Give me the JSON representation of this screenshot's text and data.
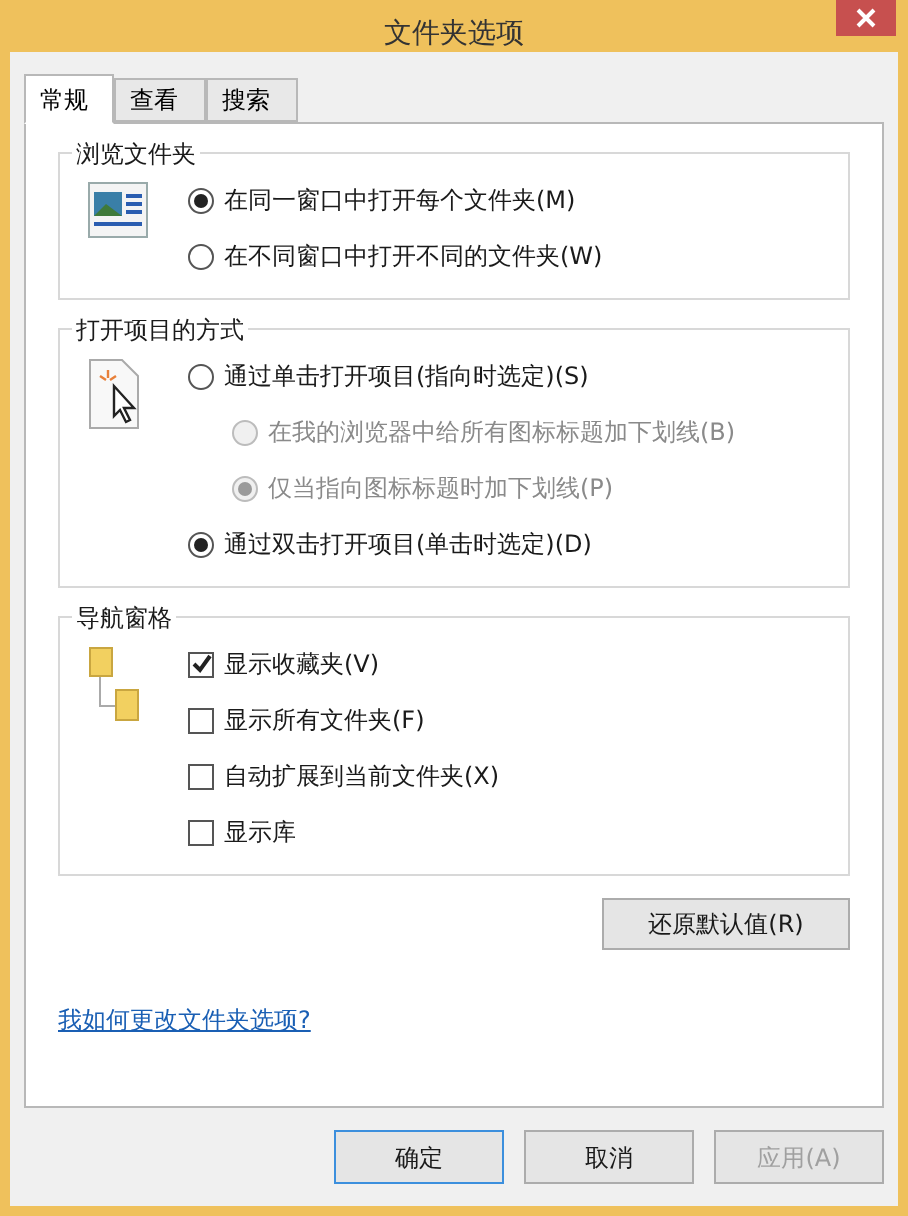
{
  "window": {
    "title": "文件夹选项"
  },
  "tabs": [
    {
      "label": "常规",
      "selected": true
    },
    {
      "label": "查看",
      "selected": false
    },
    {
      "label": "搜索",
      "selected": false
    }
  ],
  "groups": [
    {
      "title": "浏览文件夹",
      "kind": "window",
      "options": [
        {
          "kind": "radio",
          "label": "在同一窗口中打开每个文件夹(M)",
          "selected": true,
          "disabled": false
        },
        {
          "kind": "radio",
          "label": "在不同窗口中打开不同的文件夹(W)",
          "selected": false,
          "disabled": false
        }
      ]
    },
    {
      "title": "打开项目的方式",
      "kind": "click",
      "options": [
        {
          "kind": "radio",
          "label": "通过单击打开项目(指向时选定)(S)",
          "selected": false,
          "disabled": false,
          "children": [
            {
              "kind": "radio",
              "label": "在我的浏览器中给所有图标标题加下划线(B)",
              "selected": false,
              "disabled": true
            },
            {
              "kind": "radio",
              "label": "仅当指向图标标题时加下划线(P)",
              "selected": true,
              "disabled": true
            }
          ]
        },
        {
          "kind": "radio",
          "label": "通过双击打开项目(单击时选定)(D)",
          "selected": true,
          "disabled": false
        }
      ]
    },
    {
      "title": "导航窗格",
      "kind": "folders",
      "options": [
        {
          "kind": "checkbox",
          "label": "显示收藏夹(V)",
          "checked": true
        },
        {
          "kind": "checkbox",
          "label": "显示所有文件夹(F)",
          "checked": false
        },
        {
          "kind": "checkbox",
          "label": "自动扩展到当前文件夹(X)",
          "checked": false
        },
        {
          "kind": "checkbox",
          "label": "显示库",
          "checked": false
        }
      ]
    }
  ],
  "restore_button": "还原默认值(R)",
  "help_link": "我如何更改文件夹选项?",
  "buttons": [
    {
      "label": "确定",
      "default": true,
      "disabled": false
    },
    {
      "label": "取消",
      "default": false,
      "disabled": false
    },
    {
      "label": "应用(A)",
      "default": false,
      "disabled": true
    }
  ]
}
